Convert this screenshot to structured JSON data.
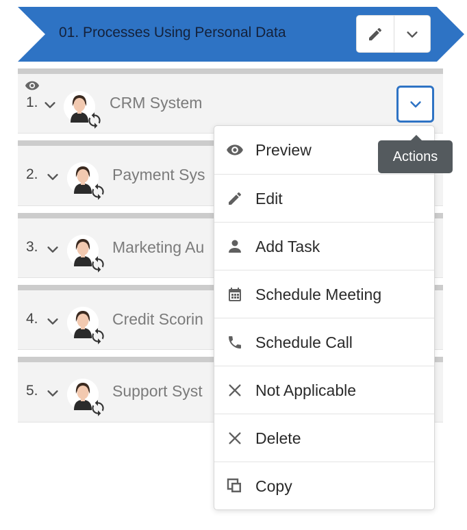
{
  "header": {
    "title": "01. Processes Using Personal Data",
    "edit_icon": "pencil-icon",
    "toggle_icon": "chevron-down-icon",
    "color": "#2e73c4"
  },
  "rows": [
    {
      "number": "1.",
      "title": "CRM System"
    },
    {
      "number": "2.",
      "title": "Payment Sys"
    },
    {
      "number": "3.",
      "title": "Marketing Au"
    },
    {
      "number": "4.",
      "title": "Credit Scorin"
    },
    {
      "number": "5.",
      "title": "Support Syst"
    }
  ],
  "menu": {
    "items": [
      {
        "label": "Preview",
        "icon": "eye-icon"
      },
      {
        "label": "Edit",
        "icon": "pencil-icon"
      },
      {
        "label": "Add Task",
        "icon": "person-icon"
      },
      {
        "label": "Schedule Meeting",
        "icon": "calendar-icon"
      },
      {
        "label": "Schedule Call",
        "icon": "phone-icon"
      },
      {
        "label": "Not Applicable",
        "icon": "close-icon"
      },
      {
        "label": "Delete",
        "icon": "close-icon"
      },
      {
        "label": "Copy",
        "icon": "copy-icon"
      }
    ]
  },
  "tooltip": {
    "text": "Actions"
  },
  "colors": {
    "accent": "#2e73c4",
    "row_bg": "#f3f3f3",
    "tooltip_bg": "#545a5e"
  }
}
